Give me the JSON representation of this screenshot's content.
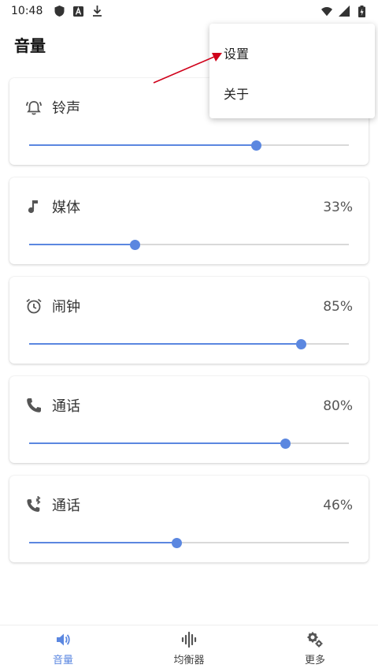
{
  "status_bar": {
    "time": "10:48"
  },
  "header": {
    "title": "音量"
  },
  "cards": [
    {
      "label": "铃声",
      "percent": "",
      "level": 0.71,
      "icon": "alarm-bell-icon"
    },
    {
      "label": "媒体",
      "percent": "33%",
      "level": 0.33,
      "icon": "music-note-icon"
    },
    {
      "label": "闹钟",
      "percent": "85%",
      "level": 0.85,
      "icon": "alarm-clock-icon"
    },
    {
      "label": "通话",
      "percent": "80%",
      "level": 0.8,
      "icon": "phone-icon"
    },
    {
      "label": "通话",
      "percent": "46%",
      "level": 0.46,
      "icon": "bluetooth-phone-icon"
    }
  ],
  "menu": {
    "items": [
      "设置",
      "关于"
    ]
  },
  "bottom_nav": {
    "items": [
      "音量",
      "均衡器",
      "更多"
    ],
    "active_index": 0
  },
  "colors": {
    "accent": "#5b87e0",
    "track": "#d9d9d9",
    "annotation_arrow": "#d0021b"
  }
}
